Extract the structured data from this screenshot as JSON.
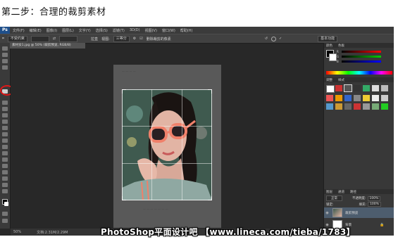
{
  "step_title": "第二步：合理的裁剪素材",
  "menubar": {
    "logo": "Ps",
    "items": [
      "文件(F)",
      "编辑(E)",
      "图像(I)",
      "图层(L)",
      "文字(Y)",
      "选择(S)",
      "滤镜(T)",
      "3D(D)",
      "视图(V)",
      "窗口(W)",
      "帮助(H)"
    ]
  },
  "options_bar": {
    "ratio_select": "不受约束",
    "straighten_label": "拉直",
    "view_label": "视图:",
    "view_value": "三等分",
    "delete_cropped_label": "删除裁剪的像素",
    "workspace": "基本功能"
  },
  "document_tab": "素材女1.jpg @ 50% (裁剪预览, RGB/8)",
  "status_bar": {
    "zoom": "50%",
    "doc_size": "文档:2.31M/2.29M"
  },
  "panels": {
    "color_tabs": [
      "颜色",
      "色板"
    ],
    "adjust_tabs": [
      "调整",
      "样式"
    ],
    "slider_labels": [
      "R",
      "G",
      "B"
    ],
    "layers_tabs": [
      "图层",
      "通道",
      "路径"
    ],
    "blend_mode": "正常",
    "opacity_label": "不透明度:",
    "opacity_value": "100%",
    "lock_label": "锁定:",
    "fill_label": "填充:",
    "fill_value": "100%",
    "layers": [
      "裁剪预览",
      "背景"
    ]
  },
  "watermark": "PhotoShop平面设计吧 【www.lineca.com/tieba/1783】",
  "colors": {
    "highlight_circle": "#e01818",
    "ps_background": "#282828"
  }
}
